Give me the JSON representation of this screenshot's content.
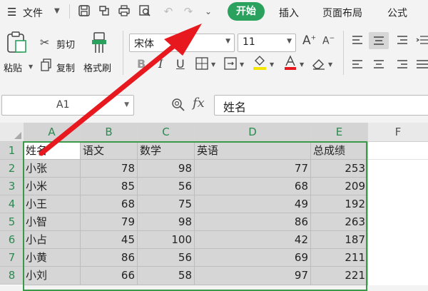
{
  "menu": {
    "file_label": "文件",
    "tabs": [
      "开始",
      "插入",
      "页面布局",
      "公式"
    ]
  },
  "ribbon": {
    "paste_label": "粘贴",
    "cut_label": "剪切",
    "copy_label": "复制",
    "format_painter_label": "格式刷",
    "font_name": "宋体",
    "font_size": "11",
    "bold_label": "B",
    "italic_label": "I",
    "underline_label": "U"
  },
  "formula_bar": {
    "cell_ref": "A1",
    "fx_label": "fx",
    "content": "姓名"
  },
  "sheet": {
    "columns": [
      "A",
      "B",
      "C",
      "D",
      "E",
      "F"
    ],
    "rows": [
      "1",
      "2",
      "3",
      "4",
      "5",
      "6",
      "7",
      "8"
    ],
    "headers": [
      "姓名",
      "语文",
      "数学",
      "英语",
      "总成绩"
    ],
    "data": [
      [
        "小张",
        "78",
        "98",
        "77",
        "253"
      ],
      [
        "小米",
        "85",
        "56",
        "68",
        "209"
      ],
      [
        "小王",
        "68",
        "75",
        "49",
        "192"
      ],
      [
        "小智",
        "79",
        "98",
        "86",
        "263"
      ],
      [
        "小占",
        "45",
        "100",
        "42",
        "187"
      ],
      [
        "小黄",
        "86",
        "56",
        "69",
        "211"
      ],
      [
        "小刘",
        "66",
        "58",
        "97",
        "221"
      ]
    ]
  },
  "colors": {
    "accent_green": "#2aa15d",
    "selection_border": "#3a9a4a",
    "arrow_red": "#e8191e"
  }
}
